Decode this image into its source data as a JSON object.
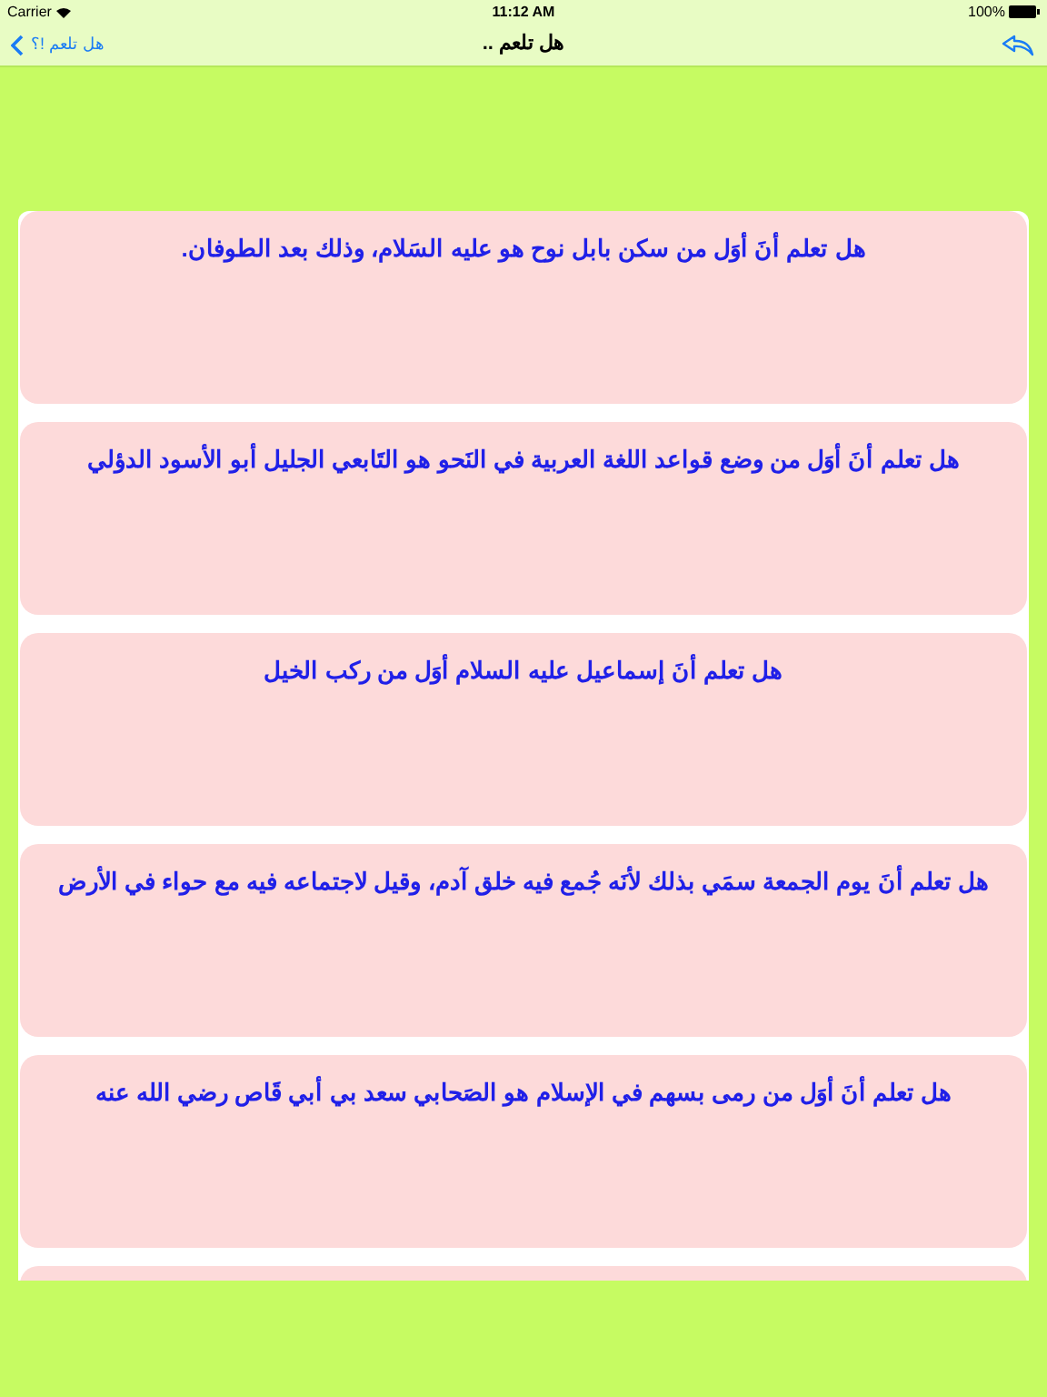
{
  "status_bar": {
    "carrier": "Carrier",
    "time": "11:12 AM",
    "battery": "100%"
  },
  "nav_bar": {
    "back_label": "هل تلعم !؟",
    "title": "هل تلعم .."
  },
  "facts": [
    {
      "text": "هل تعلم أنَ أوَل من سكن بابل نوح هو عليه السَلام، وذلك بعد الطوفان."
    },
    {
      "text": "هل تعلم أنَ أوَل من وضع قواعد اللغة العربية في النَحو هو التَابعي الجليل أبو الأسود الدؤلي"
    },
    {
      "text": "هل تعلم أنَ إسماعيل عليه السلام أوَل من ركب الخيل"
    },
    {
      "text": "هل تعلم أنَ يوم الجمعة سمَي بذلك لأنَه جُمع فيه خلق آدم، وقيل لاجتماعه فيه مع حواء في الأرض"
    },
    {
      "text": "هل تعلم أنَ أوَل من رمى بسهم في الإسلام هو الصَحابي سعد بي أبي قَاص رضي الله عنه"
    }
  ]
}
